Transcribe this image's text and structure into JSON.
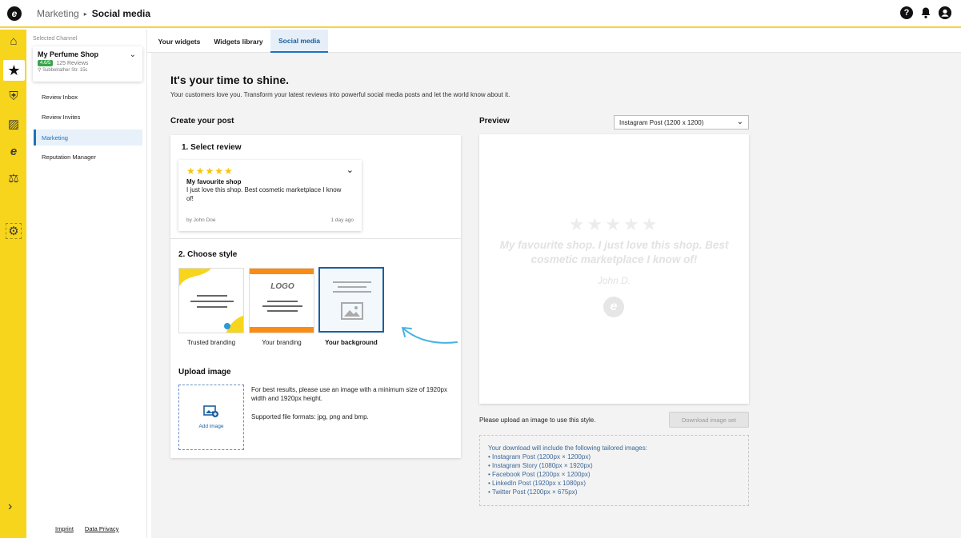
{
  "header": {
    "breadcrumb_parent": "Marketing",
    "breadcrumb_separator": "▸",
    "breadcrumb_current": "Social media",
    "help_icon_glyph": "?",
    "bell_icon_glyph": "🔔",
    "account_icon_glyph": "●"
  },
  "rail": {
    "items": [
      {
        "name": "home-icon",
        "glyph": "⌂"
      },
      {
        "name": "star-icon",
        "glyph": "★"
      },
      {
        "name": "shield-icon",
        "glyph": "⛨"
      },
      {
        "name": "chart-icon",
        "glyph": "▨"
      },
      {
        "name": "trusted-icon",
        "glyph": "e"
      },
      {
        "name": "scales-icon",
        "glyph": "⚖"
      },
      {
        "name": "settings-icon",
        "glyph": "⚙"
      }
    ],
    "expand_glyph": "›"
  },
  "sidebar": {
    "selected_channel_label": "Selected Channel",
    "channel": {
      "name": "My Perfume Shop",
      "rating": "4.6/5",
      "reviews": "125 Reviews",
      "address": "Subbelrather Str. 15c"
    },
    "items": [
      {
        "label": "Review Inbox"
      },
      {
        "label": "Review Invites"
      },
      {
        "label": "Marketing"
      },
      {
        "label": "Reputation Manager"
      }
    ],
    "footer": {
      "imprint": "Imprint",
      "privacy": "Data Privacy"
    }
  },
  "tabs": [
    {
      "label": "Your widgets"
    },
    {
      "label": "Widgets library"
    },
    {
      "label": "Social media"
    }
  ],
  "main": {
    "headline": "It's your time to shine.",
    "subline": "Your customers love you. Transform your latest reviews into powerful social media posts and let the world know about it.",
    "create_title": "Create your post",
    "step1_title": "1. Select review",
    "review": {
      "stars": "★★★★★",
      "title": "My favourite shop",
      "text": "I just love this shop. Best cosmetic marketplace I know of!",
      "author": "by John Doe",
      "date": "1 day ago"
    },
    "step2_title": "2. Choose style",
    "styles": [
      {
        "label": "Trusted branding"
      },
      {
        "label": "Your branding",
        "logo_text": "LOGO"
      },
      {
        "label": "Your background"
      }
    ],
    "upload_title": "Upload image",
    "upload_button": "Add image",
    "upload_hint": "For best results, please use an image with a minimum size of 1920px width and 1920px height.",
    "upload_formats": "Supported file formats: jpg, png and bmp."
  },
  "preview": {
    "title": "Preview",
    "format_select": "Instagram Post (1200 x 1200)",
    "stars": "★★★★★",
    "quote": "My favourite shop. I just love this shop. Best cosmetic marketplace I know of!",
    "author": "John D.",
    "logo_glyph": "e",
    "hint": "Please upload an image to use this style.",
    "download_button": "Download image set",
    "download_info_title": "Your download will include the following tailored images:",
    "download_items": [
      "• Instagram Post (1200px × 1200px)",
      "• Instagram Story (1080px × 1920px)",
      "• Facebook Post (1200px × 1200px)",
      "• LinkedIn Post (1920px x 1080px)",
      "• Twitter Post (1200px × 675px)"
    ]
  }
}
